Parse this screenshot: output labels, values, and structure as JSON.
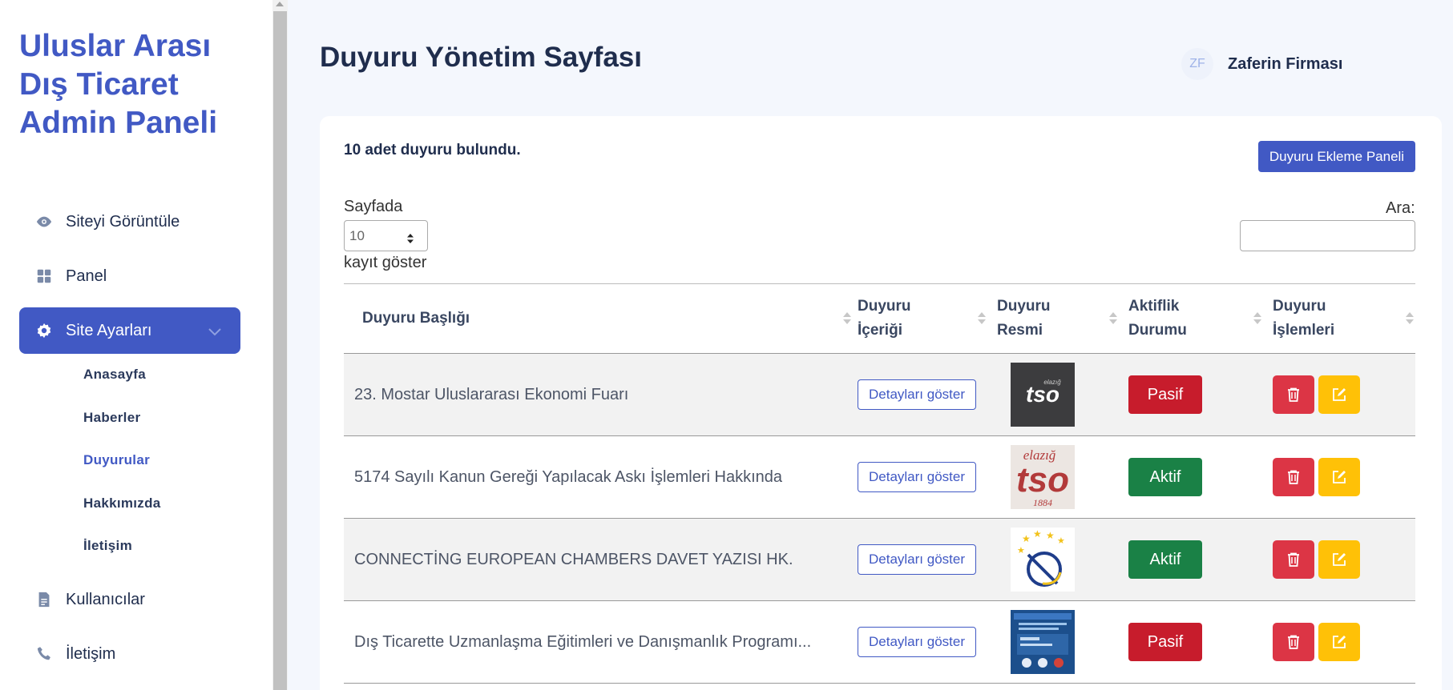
{
  "brand": {
    "line1": "Uluslar Arası",
    "line2": "Dış Ticaret",
    "line3": "Admin Paneli"
  },
  "sidebar": {
    "items": [
      {
        "label": "Siteyi Görüntüle",
        "icon": "eye-icon"
      },
      {
        "label": "Panel",
        "icon": "grid-icon"
      },
      {
        "label": "Site Ayarları",
        "icon": "gear-icon"
      },
      {
        "label": "Kullanıcılar",
        "icon": "document-icon"
      },
      {
        "label": "İletişim",
        "icon": "phone-icon"
      }
    ],
    "submenu": [
      "Anasayfa",
      "Haberler",
      "Duyurular",
      "Hakkımızda",
      "İletişim"
    ]
  },
  "header": {
    "title": "Duyuru Yönetim Sayfası",
    "avatar_initials": "ZF",
    "user_name": "Zaferin Firması"
  },
  "card": {
    "count_text": "10 adet duyuru bulundu.",
    "add_button": "Duyuru Ekleme Paneli",
    "length_label_before": "Sayfada",
    "length_value": "10",
    "length_label_after": "kayıt göster",
    "search_label": "Ara:",
    "search_value": ""
  },
  "table": {
    "headers": [
      "Duyuru Başlığı",
      "Duyuru İçeriği",
      "Duyuru Resmi",
      "Aktiflik Durumu",
      "Duyuru İşlemleri"
    ],
    "header_lines": [
      [
        "Duyuru Başlığı"
      ],
      [
        "Duyuru",
        "İçeriği"
      ],
      [
        "Duyuru",
        "Resmi"
      ],
      [
        "Aktiflik",
        "Durumu"
      ],
      [
        "Duyuru",
        "İşlemleri"
      ]
    ],
    "detail_label": "Detayları göster",
    "rows": [
      {
        "title": "23. Mostar Uluslararası Ekonomi Fuarı",
        "status": "Pasif",
        "image": "tso-logo-dark"
      },
      {
        "title": "5174 Sayılı Kanun Gereği Yapılacak Askı İşlemleri Hakkında",
        "status": "Aktif",
        "image": "elazig-tso-logo"
      },
      {
        "title": "CONNECTİNG EUROPEAN CHAMBERS DAVET YAZISI HK.",
        "status": "Aktif",
        "image": "eu-stars-logo"
      },
      {
        "title": "Dış Ticarette Uzmanlaşma Eğitimleri ve Danışmanlık Programı...",
        "status": "Pasif",
        "image": "program-poster"
      }
    ]
  },
  "colors": {
    "primary": "#4159c4",
    "danger": "#dc3545",
    "warning": "#ffc107",
    "success": "#1a8146",
    "pasif": "#c71c2c"
  }
}
